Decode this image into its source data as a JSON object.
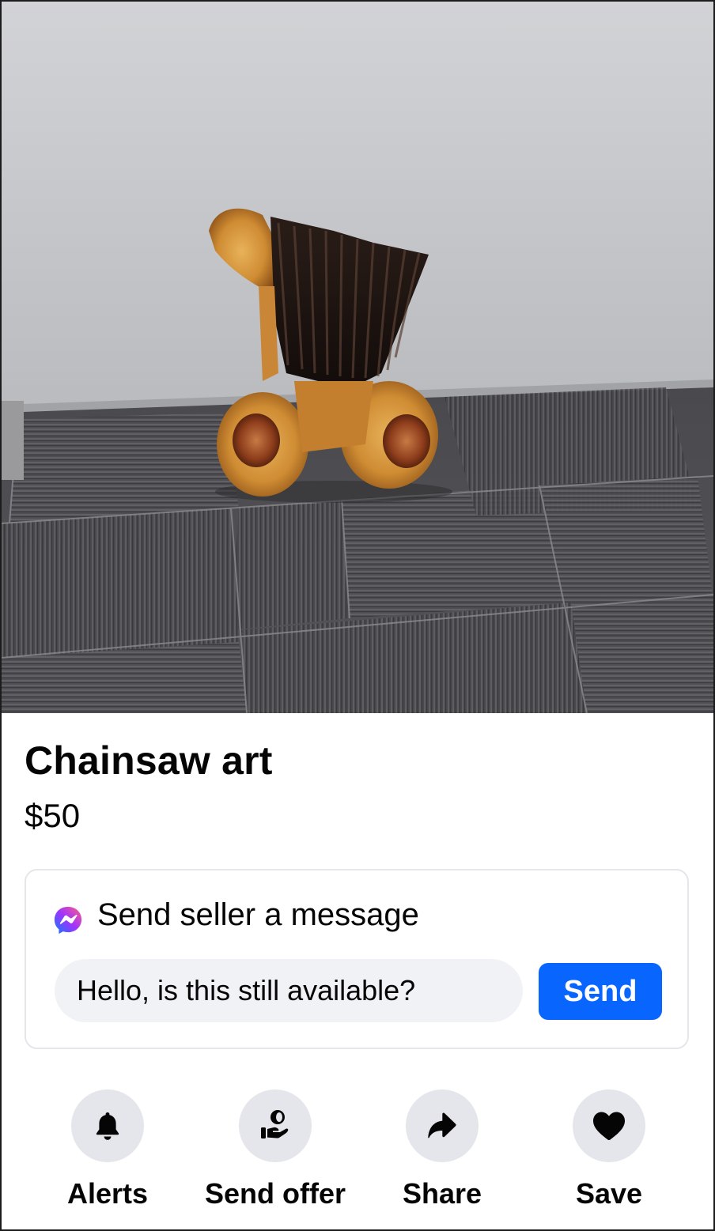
{
  "listing": {
    "title": "Chainsaw art",
    "price": "$50",
    "photo_icon": "photo-of-carved-wooden-sculpture"
  },
  "message": {
    "header": "Send seller a message",
    "icon": "messenger-icon",
    "input_value": "Hello, is this still available?",
    "send_label": "Send"
  },
  "actions": [
    {
      "label": "Alerts",
      "icon": "bell-icon"
    },
    {
      "label": "Send offer",
      "icon": "offer-icon"
    },
    {
      "label": "Share",
      "icon": "share-icon"
    },
    {
      "label": "Save",
      "icon": "heart-icon"
    }
  ],
  "colors": {
    "accent": "#0866ff",
    "input_bg": "#f0f2f5",
    "circle_bg": "#e4e6eb",
    "card_border": "#e4e6ea",
    "text": "#050505"
  }
}
